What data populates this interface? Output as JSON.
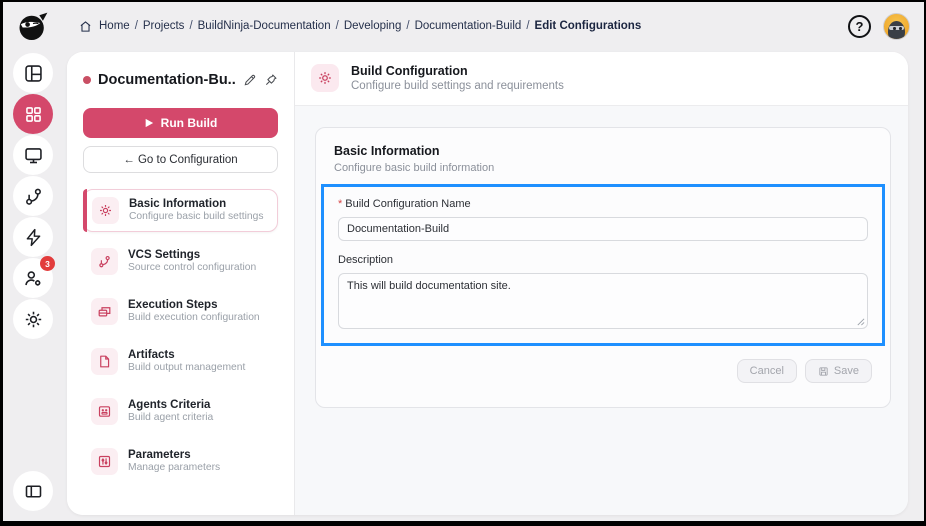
{
  "topbar": {
    "breadcrumb": {
      "separator": "/",
      "items": [
        "Home",
        "Projects",
        "BuildNinja-Documentation",
        "Developing",
        "Documentation-Build",
        "Edit Configurations"
      ]
    },
    "help_label": "?"
  },
  "rail": {
    "badge_count": "3"
  },
  "panel": {
    "title": "Documentation-Bu...",
    "run_button_label": "Run Build",
    "goto_button_label": "← Go to Configuration",
    "nav": [
      {
        "title": "Basic Information",
        "subtitle": "Configure basic build settings"
      },
      {
        "title": "VCS Settings",
        "subtitle": "Source control configuration"
      },
      {
        "title": "Execution Steps",
        "subtitle": "Build execution configuration"
      },
      {
        "title": "Artifacts",
        "subtitle": "Build output management"
      },
      {
        "title": "Agents Criteria",
        "subtitle": "Build agent criteria"
      },
      {
        "title": "Parameters",
        "subtitle": "Manage parameters"
      }
    ]
  },
  "main": {
    "header": {
      "title": "Build Configuration",
      "subtitle": "Configure build settings and requirements"
    },
    "card": {
      "title": "Basic Information",
      "subtitle": "Configure basic build information",
      "name_field": {
        "required_marker": "*",
        "label": "Build Configuration Name",
        "value": "Documentation-Build"
      },
      "description_field": {
        "label": "Description",
        "value": "This will build documentation site."
      },
      "cancel_label": "Cancel",
      "save_label": "Save"
    }
  },
  "colors": {
    "accent": "#d4486b",
    "highlight_border": "#1e90ff",
    "badge": "#e23c3c",
    "avatar_bg": "#efa92f"
  }
}
